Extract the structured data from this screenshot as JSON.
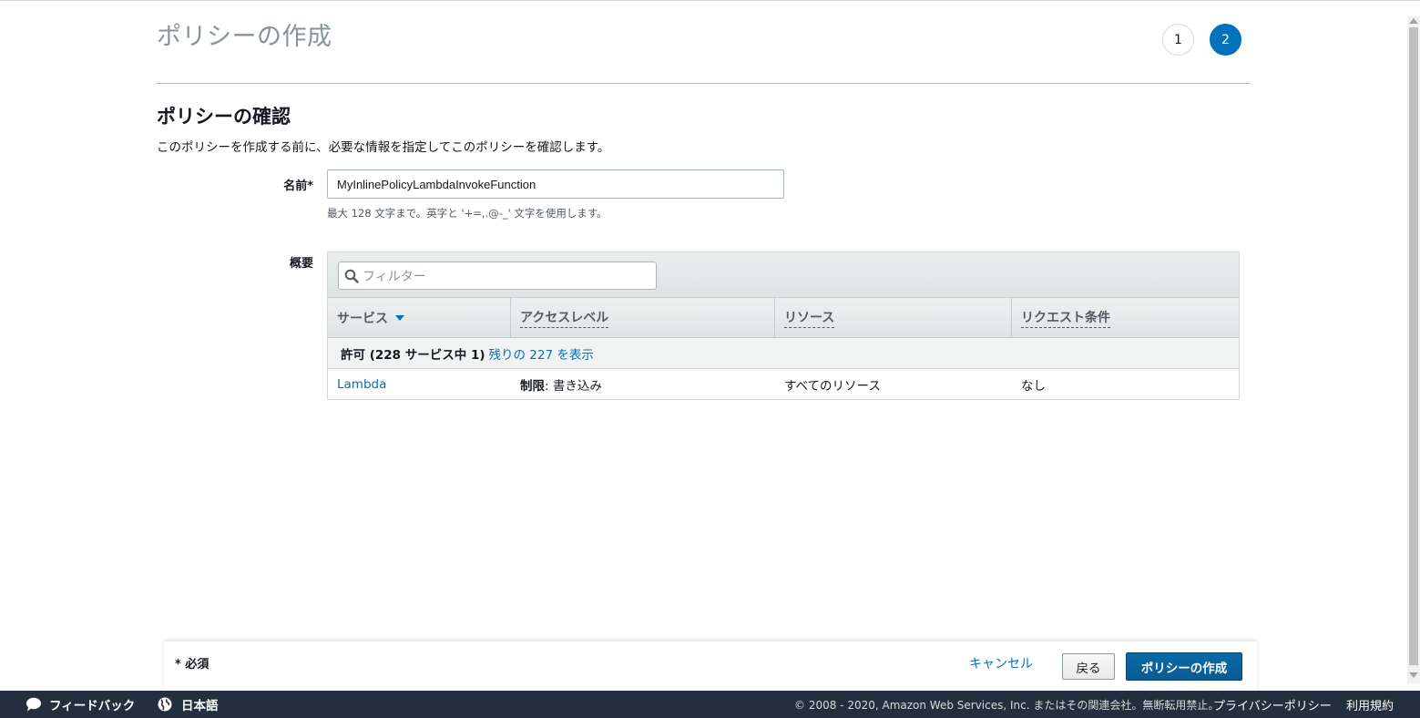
{
  "header": {
    "title": "ポリシーの作成",
    "steps": [
      "1",
      "2"
    ]
  },
  "review": {
    "title": "ポリシーの確認",
    "description": "このポリシーを作成する前に、必要な情報を指定してこのポリシーを確認します。"
  },
  "name_field": {
    "label": "名前*",
    "value": "MyInlinePolicyLambdaInvokeFunction",
    "hint": "最大 128 文字まで。英字と '+=,.@-_' 文字を使用します。"
  },
  "summary": {
    "label": "概要",
    "filter_placeholder": "フィルター",
    "columns": [
      "サービス",
      "アクセスレベル",
      "リソース",
      "リクエスト条件"
    ],
    "group": {
      "label": "許可 (228 サービス中 1)",
      "link": "残りの 227 を表示"
    },
    "rows": [
      {
        "service": "Lambda",
        "access_prefix": "制限",
        "access_value": ": 書き込み",
        "resource": "すべてのリソース",
        "condition": "なし"
      }
    ]
  },
  "footer": {
    "required_note": "* 必須",
    "cancel": "キャンセル",
    "back": "戻る",
    "create": "ポリシーの作成"
  },
  "bottombar": {
    "feedback": "フィードバック",
    "language": "日本語",
    "copyright": "© 2008 - 2020, Amazon Web Services, Inc. またはその関連会社。無断転用禁止。",
    "privacy": "プライバシーポリシー",
    "terms": "利用規約"
  },
  "colors": {
    "accent": "#0073bb",
    "bottombar": "#232f3e",
    "primary_button": "#0b5a92"
  }
}
